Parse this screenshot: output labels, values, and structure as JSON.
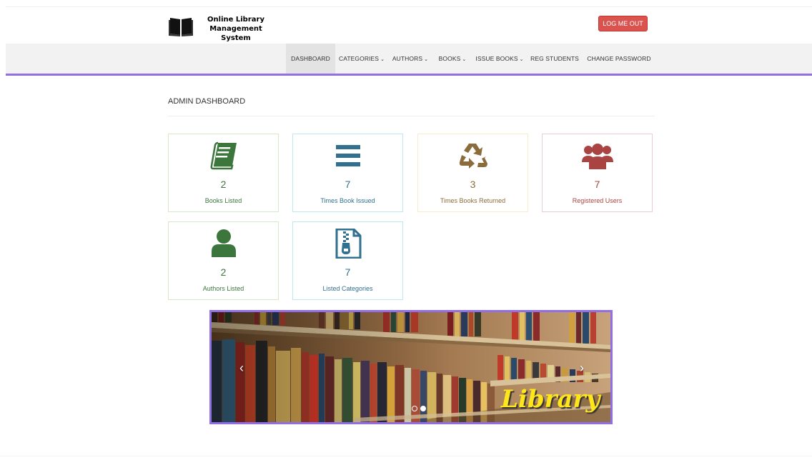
{
  "header": {
    "title_line1": "Online Library",
    "title_line2": "Management System",
    "logout_label": "LOG ME OUT"
  },
  "nav": {
    "items": [
      {
        "label": "DASHBOARD",
        "dropdown": false,
        "active": true
      },
      {
        "label": "CATEGORIES",
        "dropdown": true
      },
      {
        "label": "AUTHORS",
        "dropdown": true
      },
      {
        "label": "BOOKS",
        "dropdown": true
      },
      {
        "label": "ISSUE BOOKS",
        "dropdown": true
      },
      {
        "label": "REG STUDENTS",
        "dropdown": false
      },
      {
        "label": "CHANGE PASSWORD",
        "dropdown": false
      }
    ],
    "caret": "⌄"
  },
  "page": {
    "title": "ADMIN DASHBOARD"
  },
  "cards": [
    {
      "count": "2",
      "label": "Books Listed",
      "icon": "book-icon",
      "color": "#3c763d"
    },
    {
      "count": "7",
      "label": "Times Book Issued",
      "icon": "bars-icon",
      "color": "#31708f"
    },
    {
      "count": "3",
      "label": "Times Books Returned",
      "icon": "recycle-icon",
      "color": "#8a6d3b"
    },
    {
      "count": "7",
      "label": "Registered Users",
      "icon": "users-icon",
      "color": "#a94442"
    },
    {
      "count": "2",
      "label": "Authors Listed",
      "icon": "user-icon",
      "color": "#3c763d"
    },
    {
      "count": "7",
      "label": "Listed Categories",
      "icon": "file-archive-icon",
      "color": "#31708f"
    }
  ],
  "carousel": {
    "caption": "Library",
    "prev": "‹",
    "next": "›",
    "slides": 2,
    "active_slide": 1,
    "border_color": "#8f6fe3"
  },
  "colors": {
    "accent": "#9170e6",
    "danger": "#d9534f"
  }
}
